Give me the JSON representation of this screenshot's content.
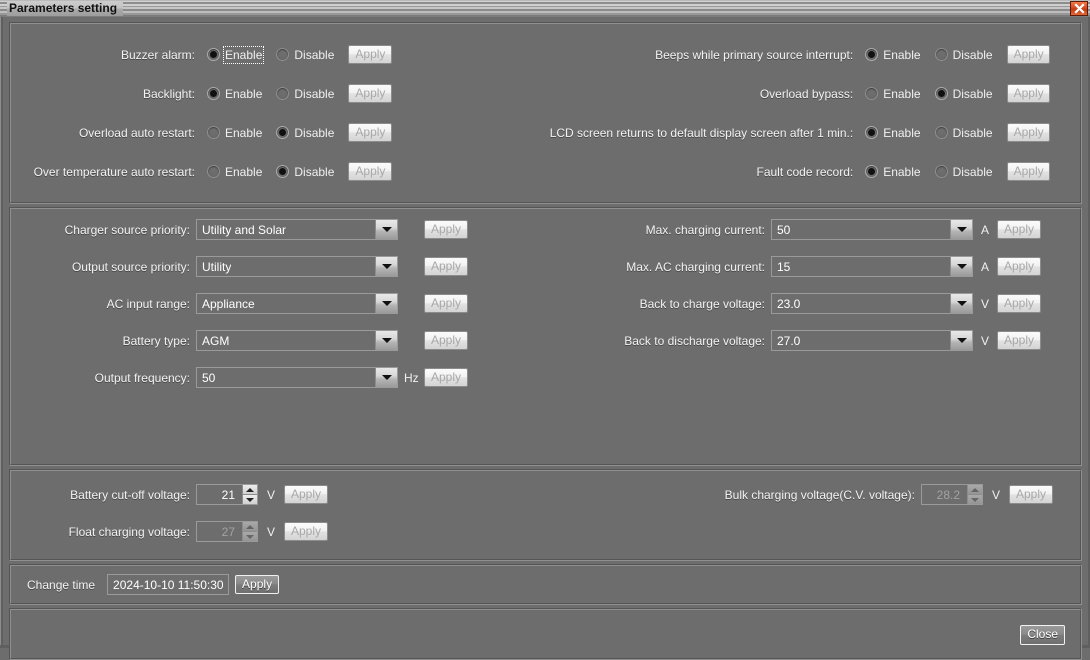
{
  "window": {
    "title": "Parameters setting",
    "close_icon": "close-x-icon"
  },
  "toggle_section": {
    "left_rows": [
      {
        "label": "Buzzer alarm:",
        "enable_label": "Enable",
        "disable_label": "Disable",
        "selected": "enable",
        "apply_label": "Apply",
        "apply_enabled": false,
        "focused": true
      },
      {
        "label": "Backlight:",
        "enable_label": "Enable",
        "disable_label": "Disable",
        "selected": "enable",
        "apply_label": "Apply",
        "apply_enabled": false,
        "focused": false
      },
      {
        "label": "Overload auto restart:",
        "enable_label": "Enable",
        "disable_label": "Disable",
        "selected": "disable",
        "apply_label": "Apply",
        "apply_enabled": false,
        "focused": false
      },
      {
        "label": "Over temperature auto restart:",
        "enable_label": "Enable",
        "disable_label": "Disable",
        "selected": "disable",
        "apply_label": "Apply",
        "apply_enabled": false,
        "focused": false
      }
    ],
    "right_rows": [
      {
        "label": "Beeps while primary source interrupt:",
        "enable_label": "Enable",
        "disable_label": "Disable",
        "selected": "enable",
        "apply_label": "Apply",
        "apply_enabled": false
      },
      {
        "label": "Overload bypass:",
        "enable_label": "Enable",
        "disable_label": "Disable",
        "selected": "disable",
        "apply_label": "Apply",
        "apply_enabled": false
      },
      {
        "label": "LCD screen returns to default display screen after 1 min.:",
        "enable_label": "Enable",
        "disable_label": "Disable",
        "selected": "enable",
        "apply_label": "Apply",
        "apply_enabled": false
      },
      {
        "label": "Fault code record:",
        "enable_label": "Enable",
        "disable_label": "Disable",
        "selected": "enable",
        "apply_label": "Apply",
        "apply_enabled": false
      }
    ]
  },
  "combo_section": {
    "left_rows": [
      {
        "label": "Charger source priority:",
        "value": "Utility and Solar",
        "unit": "",
        "apply_label": "Apply"
      },
      {
        "label": "Output source priority:",
        "value": "Utility",
        "unit": "",
        "apply_label": "Apply"
      },
      {
        "label": "AC input range:",
        "value": "Appliance",
        "unit": "",
        "apply_label": "Apply"
      },
      {
        "label": "Battery type:",
        "value": "AGM",
        "unit": "",
        "apply_label": "Apply"
      },
      {
        "label": "Output frequency:",
        "value": "50",
        "unit": "Hz",
        "apply_label": "Apply"
      }
    ],
    "right_rows": [
      {
        "label": "Max. charging current:",
        "value": "50",
        "unit": "A",
        "apply_label": "Apply"
      },
      {
        "label": "Max. AC charging current:",
        "value": "15",
        "unit": "A",
        "apply_label": "Apply"
      },
      {
        "label": "Back to charge voltage:",
        "value": "23.0",
        "unit": "V",
        "apply_label": "Apply"
      },
      {
        "label": "Back to discharge voltage:",
        "value": "27.0",
        "unit": "V",
        "apply_label": "Apply"
      }
    ]
  },
  "spin_section": {
    "left_rows": [
      {
        "label": "Battery cut-off voltage:",
        "value": "21",
        "unit": "V",
        "apply_label": "Apply",
        "disabled": false
      },
      {
        "label": "Float charging voltage:",
        "value": "27",
        "unit": "V",
        "apply_label": "Apply",
        "disabled": true
      }
    ],
    "right_rows": [
      {
        "label": "Bulk charging voltage(C.V. voltage):",
        "value": "28.2",
        "unit": "V",
        "apply_label": "Apply",
        "disabled": true
      }
    ]
  },
  "time_section": {
    "label": "Change time",
    "value": "2024-10-10 11:50:30",
    "apply_label": "Apply"
  },
  "footer": {
    "close_label": "Close"
  },
  "colors": {
    "background": "#6d6d6d",
    "panel_border_dark": "#555555",
    "panel_border_light": "#8f8f8f",
    "text": "#ffffff",
    "disabled_text": "#a8a8a8",
    "close_button_red": "#d84a20"
  }
}
